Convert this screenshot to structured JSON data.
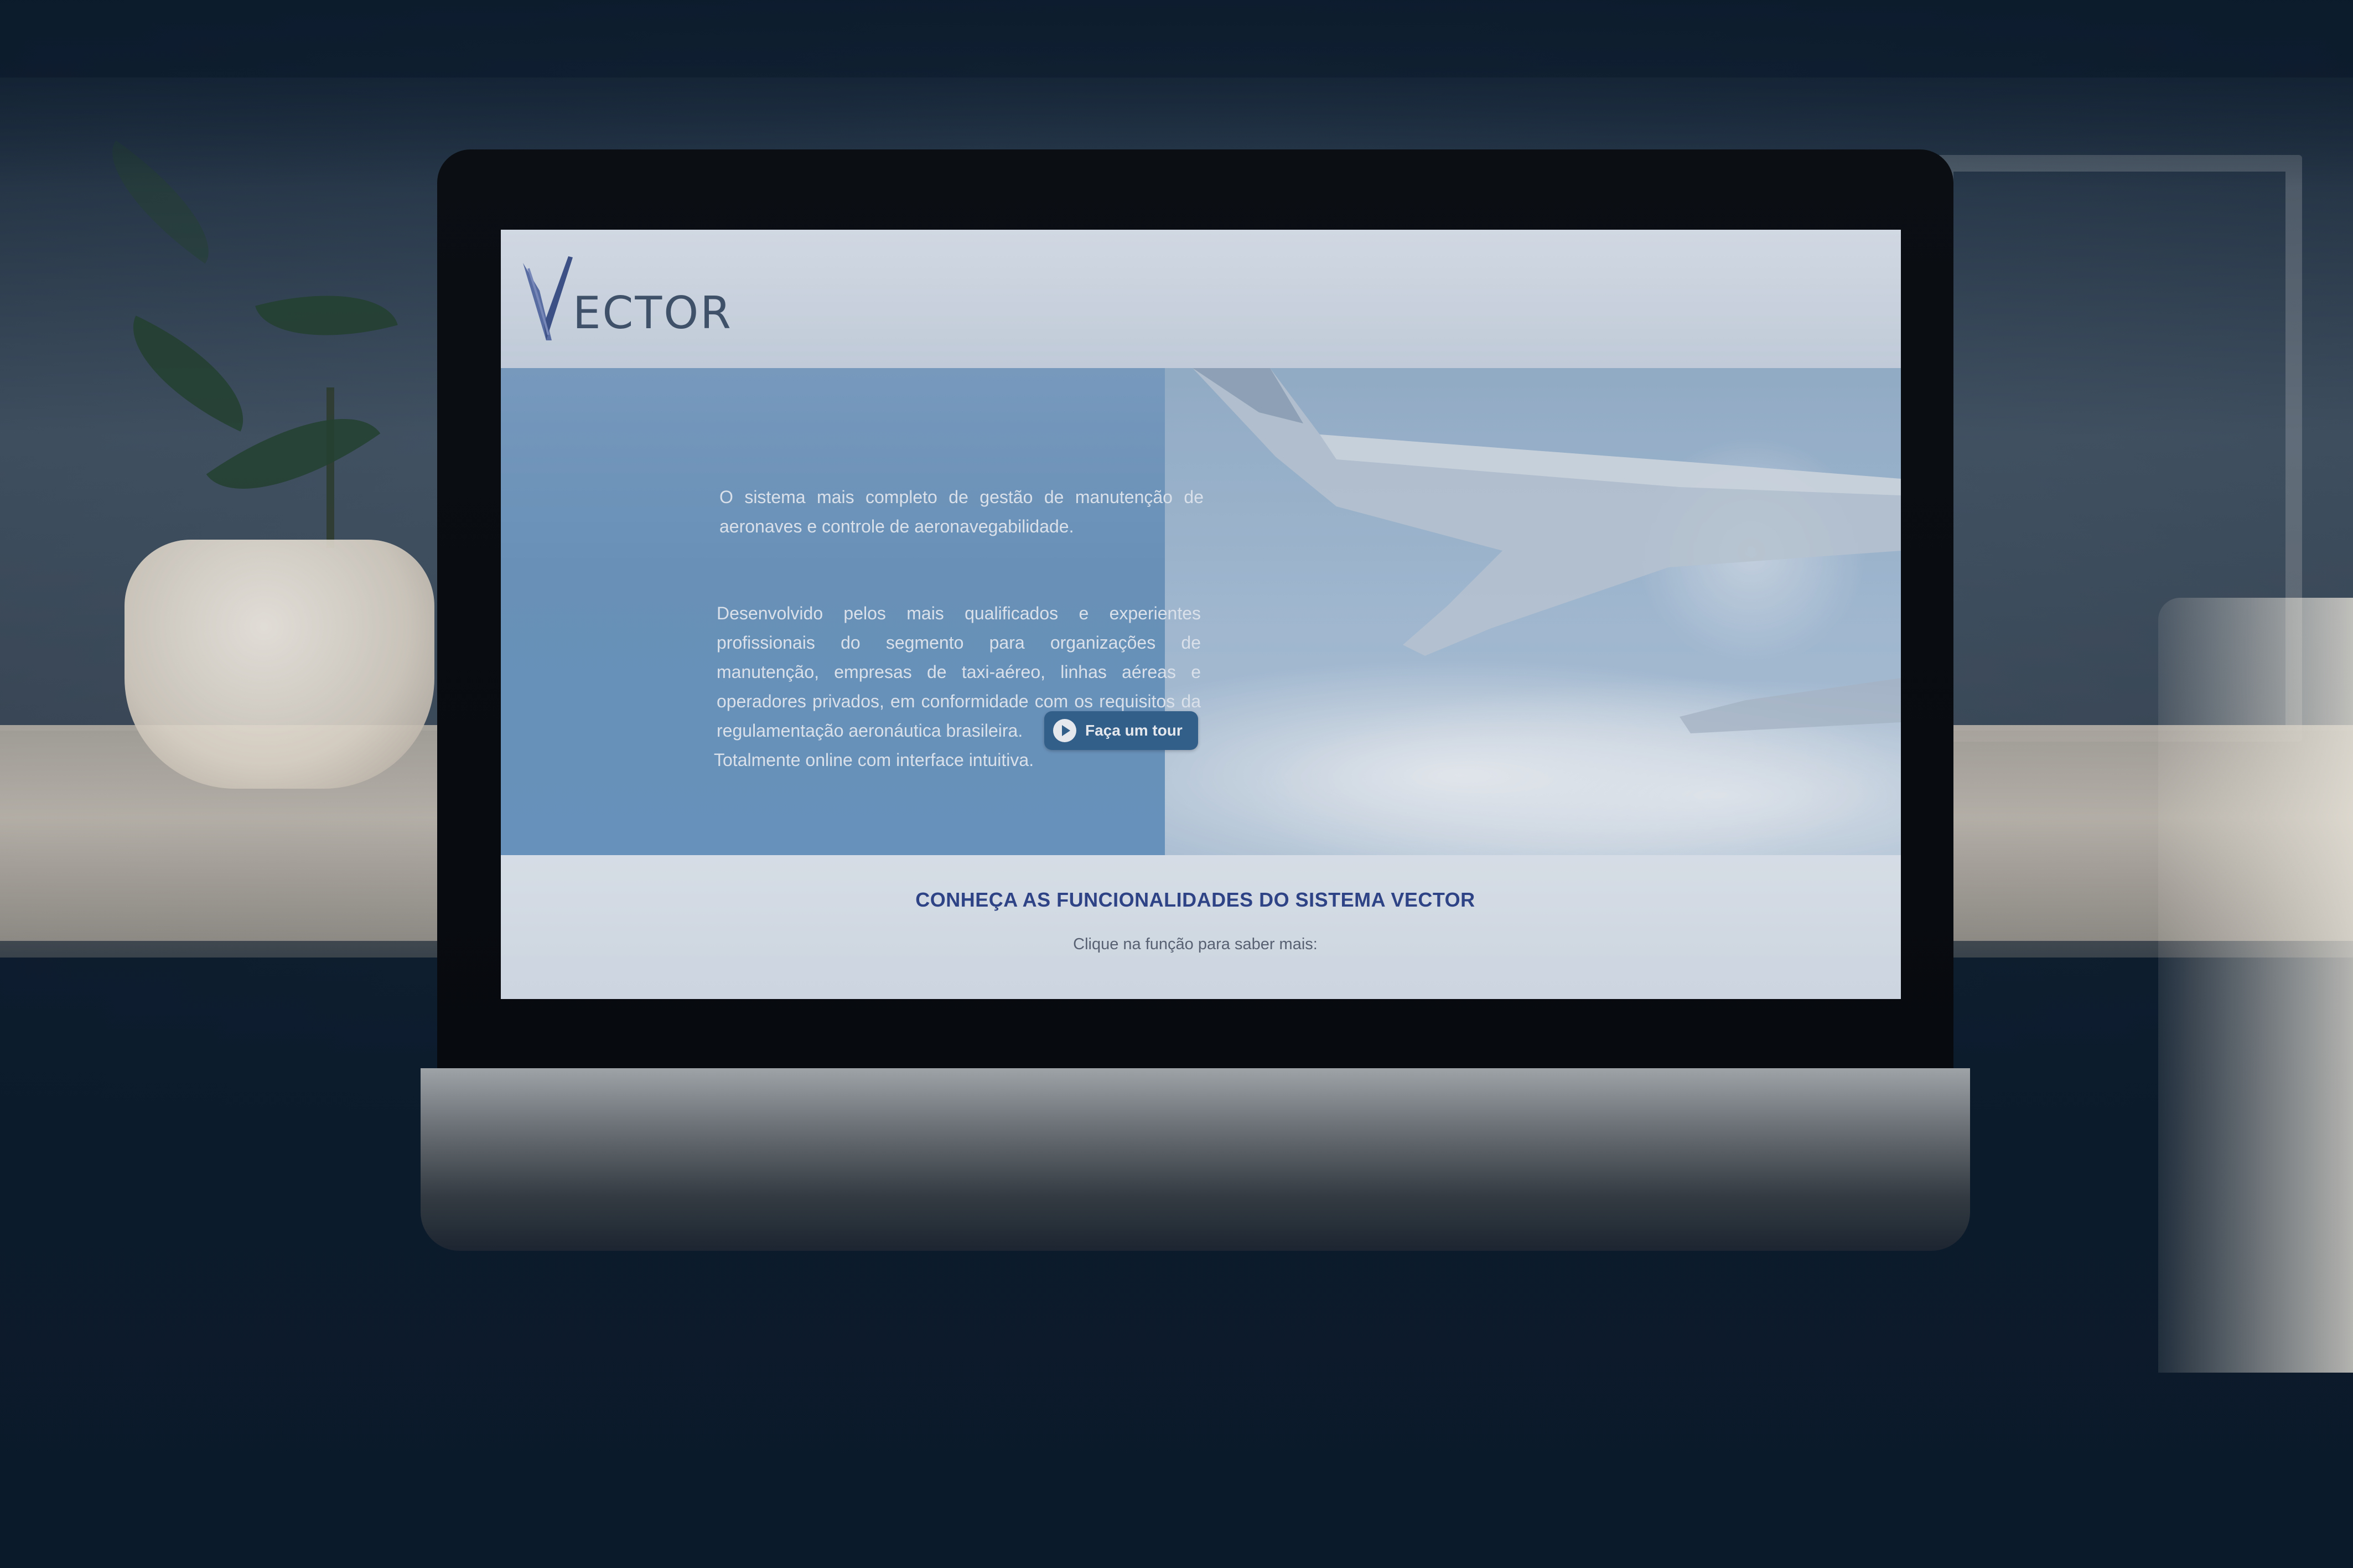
{
  "site": {
    "logo_text": "ECTOR",
    "logo_alt": "VECTOR"
  },
  "hero": {
    "paragraph_1": "O sistema mais completo de gestão de manutenção de aeronaves e controle de aeronavegabilidade.",
    "paragraph_2": "Desenvolvido pelos mais qualificados e experientes profissionais do segmento para organizações de manutenção, empresas de taxi-aéreo, linhas aéreas e operadores privados, em conformidade com os requisitos da regulamentação aeronáutica brasileira.",
    "paragraph_3": "Totalmente online com interface intuitiva.",
    "tour_button_label": "Faça um tour"
  },
  "features": {
    "title": "CONHEÇA AS FUNCIONALIDADES DO SISTEMA VECTOR",
    "subtitle": "Clique na função para saber mais:"
  },
  "colors": {
    "brand_blue": "#2b3f86",
    "button_blue": "#2f5f8c",
    "hero_blue": "#6f9ac2",
    "background_navy": "#0c1b2c"
  },
  "icons": {
    "logo": "vector-v-logo-icon",
    "tour": "play-icon"
  }
}
